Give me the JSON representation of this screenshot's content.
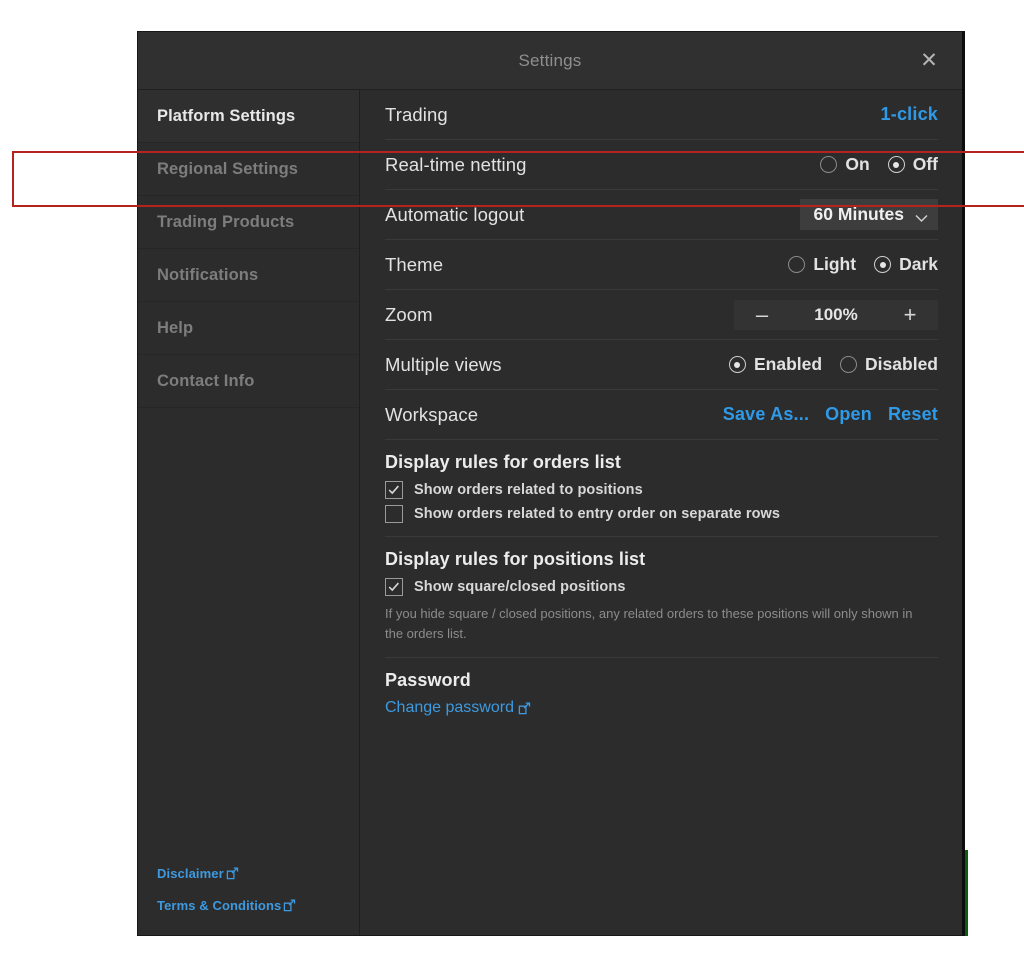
{
  "dialog": {
    "title": "Settings",
    "close_icon": "close-icon"
  },
  "sidebar": {
    "items": [
      {
        "label": "Platform Settings",
        "active": true
      },
      {
        "label": "Regional Settings",
        "active": false
      },
      {
        "label": "Trading Products",
        "active": false
      },
      {
        "label": "Notifications",
        "active": false
      },
      {
        "label": "Help",
        "active": false
      },
      {
        "label": "Contact Info",
        "active": false
      }
    ],
    "footer_links": [
      {
        "label": "Disclaimer",
        "icon": "external-link-icon"
      },
      {
        "label": "Terms & Conditions",
        "icon": "external-link-icon"
      }
    ]
  },
  "settings": {
    "trading": {
      "label": "Trading",
      "value": "1-click"
    },
    "netting": {
      "label": "Real-time netting",
      "options": [
        {
          "label": "On",
          "selected": false
        },
        {
          "label": "Off",
          "selected": true
        }
      ]
    },
    "logout": {
      "label": "Automatic logout",
      "value": "60 Minutes",
      "chevron": "chevron-down-icon"
    },
    "theme": {
      "label": "Theme",
      "options": [
        {
          "label": "Light",
          "selected": false
        },
        {
          "label": "Dark",
          "selected": true
        }
      ]
    },
    "zoom": {
      "label": "Zoom",
      "minus": "–",
      "value": "100%",
      "plus": "+"
    },
    "multiple_views": {
      "label": "Multiple views",
      "options": [
        {
          "label": "Enabled",
          "selected": true
        },
        {
          "label": "Disabled",
          "selected": false
        }
      ]
    },
    "workspace": {
      "label": "Workspace",
      "actions": [
        {
          "label": "Save As..."
        },
        {
          "label": "Open"
        },
        {
          "label": "Reset"
        }
      ]
    }
  },
  "orders_section": {
    "title": "Display rules for orders list",
    "checkboxes": [
      {
        "label": "Show orders related to positions",
        "checked": true
      },
      {
        "label": "Show orders related to entry order on separate rows",
        "checked": false
      }
    ]
  },
  "positions_section": {
    "title": "Display rules for positions list",
    "checkboxes": [
      {
        "label": "Show square/closed positions",
        "checked": true
      }
    ],
    "hint": "If you hide square / closed positions, any related orders to these positions will only shown in the orders list."
  },
  "password_section": {
    "title": "Password",
    "link": {
      "label": "Change password",
      "icon": "external-link-icon"
    }
  },
  "colors": {
    "accent_blue": "#2f9ae8",
    "link_blue": "#3d9ae0",
    "dialog_bg": "#2c2c2c",
    "titlebar_bg": "#303030",
    "annotation_red": "#b4231f",
    "divider": "#3a3a3a"
  }
}
